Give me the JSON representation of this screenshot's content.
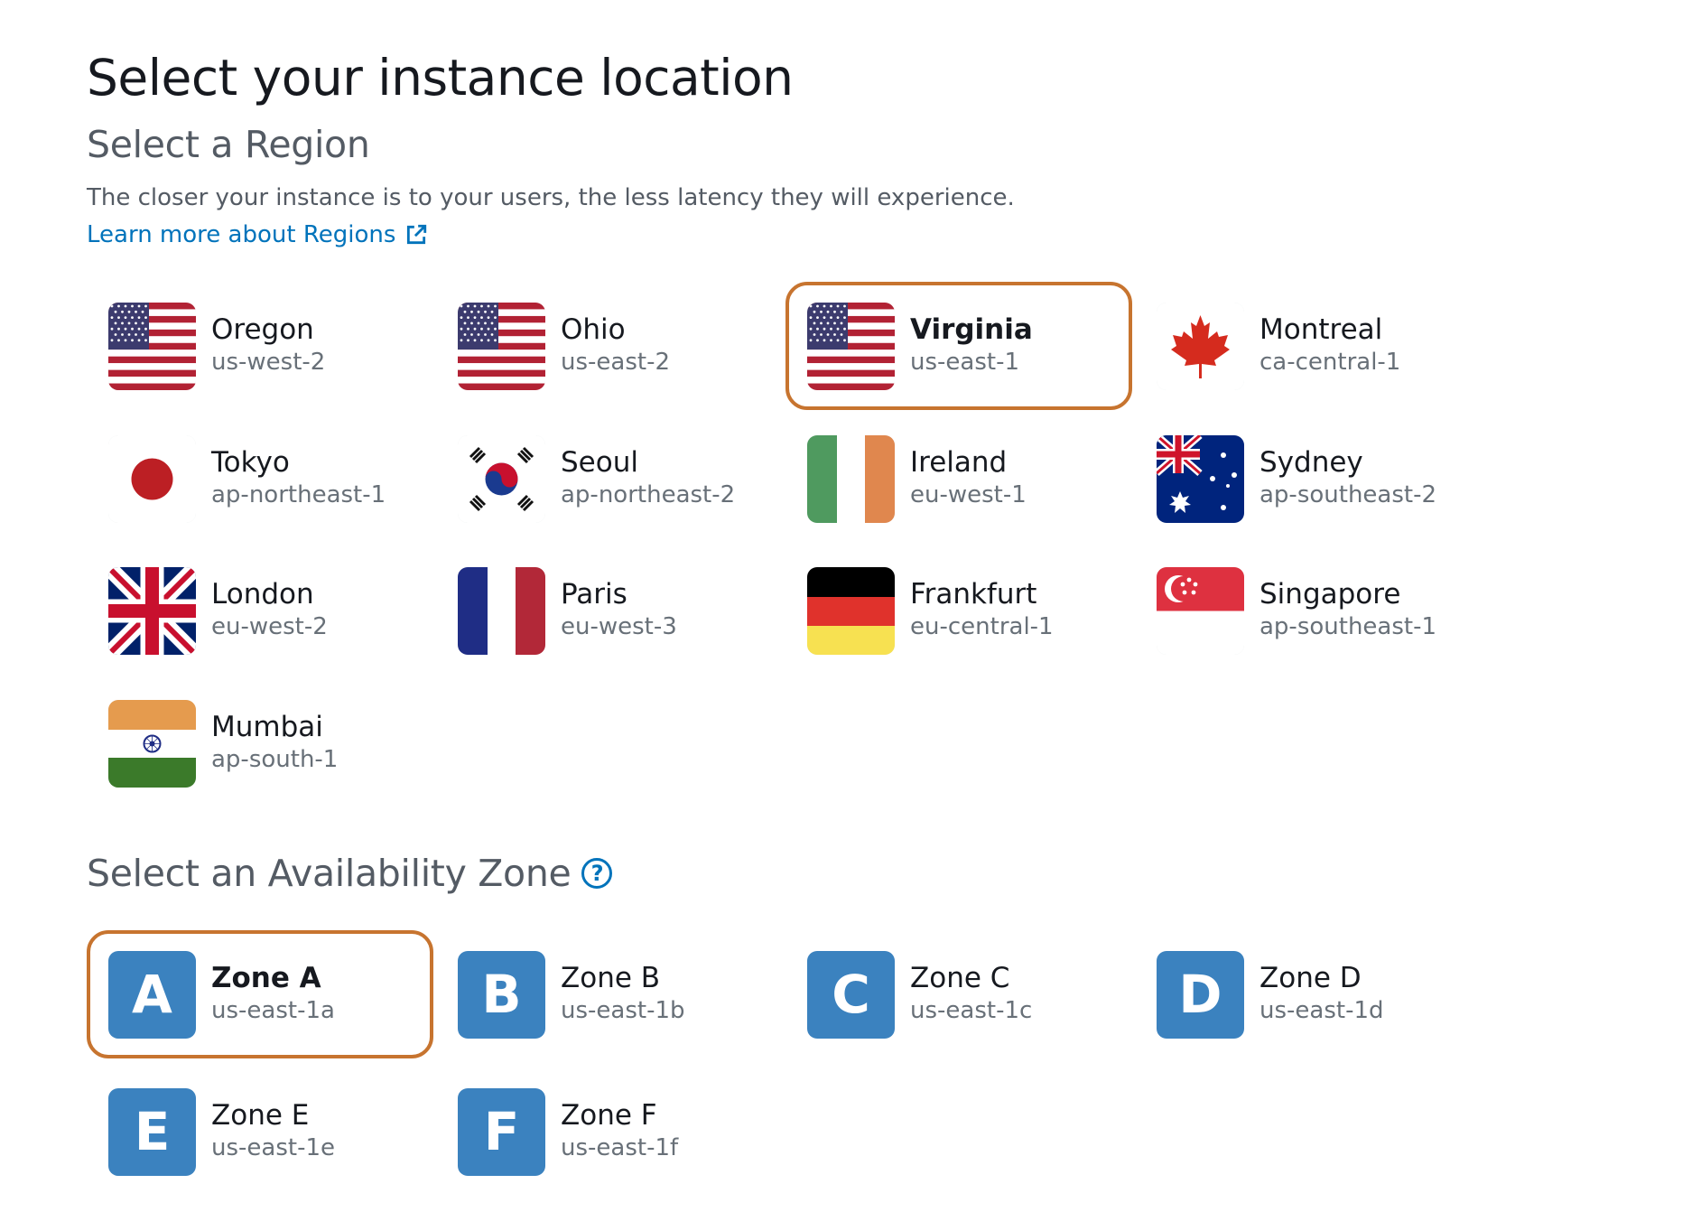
{
  "page_title": "Select your instance location",
  "region_section": {
    "title": "Select a Region",
    "description": "The closer your instance is to your users, the less latency they will experience.",
    "learn_more": "Learn more about Regions"
  },
  "regions": [
    {
      "name": "Oregon",
      "code": "us-west-2",
      "flag": "us-flag",
      "selected": false
    },
    {
      "name": "Ohio",
      "code": "us-east-2",
      "flag": "us-flag",
      "selected": false
    },
    {
      "name": "Virginia",
      "code": "us-east-1",
      "flag": "us-flag",
      "selected": true
    },
    {
      "name": "Montreal",
      "code": "ca-central-1",
      "flag": "canada-flag",
      "selected": false
    },
    {
      "name": "Tokyo",
      "code": "ap-northeast-1",
      "flag": "japan-flag",
      "selected": false
    },
    {
      "name": "Seoul",
      "code": "ap-northeast-2",
      "flag": "korea-flag",
      "selected": false
    },
    {
      "name": "Ireland",
      "code": "eu-west-1",
      "flag": "ireland-flag",
      "selected": false
    },
    {
      "name": "Sydney",
      "code": "ap-southeast-2",
      "flag": "australia-flag",
      "selected": false
    },
    {
      "name": "London",
      "code": "eu-west-2",
      "flag": "uk-flag",
      "selected": false
    },
    {
      "name": "Paris",
      "code": "eu-west-3",
      "flag": "france-flag",
      "selected": false
    },
    {
      "name": "Frankfurt",
      "code": "eu-central-1",
      "flag": "germany-flag",
      "selected": false
    },
    {
      "name": "Singapore",
      "code": "ap-southeast-1",
      "flag": "singapore-flag",
      "selected": false
    },
    {
      "name": "Mumbai",
      "code": "ap-south-1",
      "flag": "india-flag",
      "selected": false
    }
  ],
  "az_section": {
    "title": "Select an Availability Zone",
    "help_glyph": "?"
  },
  "zones": [
    {
      "letter": "A",
      "name": "Zone A",
      "code": "us-east-1a",
      "selected": true
    },
    {
      "letter": "B",
      "name": "Zone B",
      "code": "us-east-1b",
      "selected": false
    },
    {
      "letter": "C",
      "name": "Zone C",
      "code": "us-east-1c",
      "selected": false
    },
    {
      "letter": "D",
      "name": "Zone D",
      "code": "us-east-1d",
      "selected": false
    },
    {
      "letter": "E",
      "name": "Zone E",
      "code": "us-east-1e",
      "selected": false
    },
    {
      "letter": "F",
      "name": "Zone F",
      "code": "us-east-1f",
      "selected": false
    }
  ],
  "colors": {
    "selected_border": "#c7742f",
    "link": "#0073bb",
    "zone_badge": "#3b82bf"
  }
}
